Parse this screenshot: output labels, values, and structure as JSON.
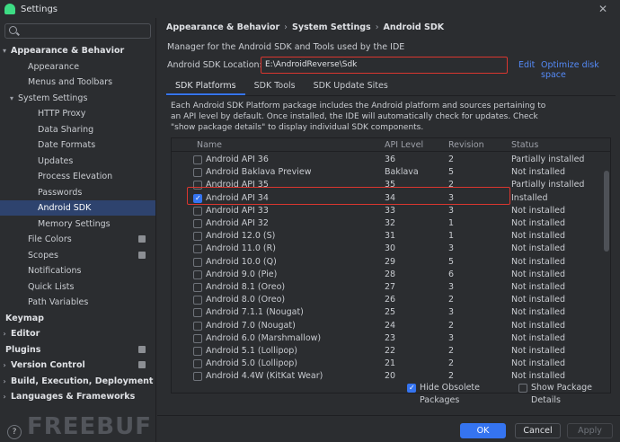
{
  "window": {
    "title": "Settings"
  },
  "search": {
    "placeholder": ""
  },
  "sidebar": {
    "items": [
      {
        "label": "Appearance & Behavior",
        "bold": true,
        "arrow": "▾",
        "indent": 0
      },
      {
        "label": "Appearance",
        "indent": 2
      },
      {
        "label": "Menus and Toolbars",
        "indent": 2
      },
      {
        "label": "System Settings",
        "arrow": "▾",
        "indent": 1
      },
      {
        "label": "HTTP Proxy",
        "indent": 3
      },
      {
        "label": "Data Sharing",
        "indent": 3
      },
      {
        "label": "Date Formats",
        "indent": 3
      },
      {
        "label": "Updates",
        "indent": 3
      },
      {
        "label": "Process Elevation",
        "indent": 3
      },
      {
        "label": "Passwords",
        "indent": 3
      },
      {
        "label": "Android SDK",
        "indent": 3,
        "selected": true
      },
      {
        "label": "Memory Settings",
        "indent": 3
      },
      {
        "label": "File Colors",
        "indent": 2,
        "project": true
      },
      {
        "label": "Scopes",
        "indent": 2,
        "project": true
      },
      {
        "label": "Notifications",
        "indent": 2
      },
      {
        "label": "Quick Lists",
        "indent": 2
      },
      {
        "label": "Path Variables",
        "indent": 2
      },
      {
        "label": "Keymap",
        "bold": true,
        "indent": 0
      },
      {
        "label": "Editor",
        "bold": true,
        "arrow": "›",
        "indent": 0
      },
      {
        "label": "Plugins",
        "bold": true,
        "indent": 0,
        "project": true
      },
      {
        "label": "Version Control",
        "bold": true,
        "arrow": "›",
        "indent": 0,
        "project": true
      },
      {
        "label": "Build, Execution, Deployment",
        "bold": true,
        "arrow": "›",
        "indent": 0
      },
      {
        "label": "Languages & Frameworks",
        "bold": true,
        "arrow": "›",
        "indent": 0
      }
    ],
    "help_label": "?",
    "watermark": "FREEBUF"
  },
  "main": {
    "breadcrumb": [
      "Appearance & Behavior",
      "System Settings",
      "Android SDK"
    ],
    "description": "Manager for the Android SDK and Tools used by the IDE",
    "location_label": "Android SDK Location:",
    "location_value": "E:\\AndroidReverse\\Sdk",
    "edit_link": "Edit",
    "optimize_link": "Optimize disk space",
    "tabs": [
      "SDK Platforms",
      "SDK Tools",
      "SDK Update Sites"
    ],
    "active_tab": 0,
    "tab_description": "Each Android SDK Platform package includes the Android platform and sources pertaining to an API level by default. Once installed, the IDE will automatically check for updates. Check \"show package details\" to display individual SDK components.",
    "columns": [
      "Name",
      "API Level",
      "Revision",
      "Status"
    ],
    "rows": [
      {
        "name": "Android API 36",
        "api": "36",
        "rev": "2",
        "status": "Partially installed",
        "checked": false
      },
      {
        "name": "Android Baklava Preview",
        "api": "Baklava",
        "rev": "5",
        "status": "Not installed",
        "checked": false
      },
      {
        "name": "Android API 35",
        "api": "35",
        "rev": "2",
        "status": "Partially installed",
        "checked": false
      },
      {
        "name": "Android API 34",
        "api": "34",
        "rev": "3",
        "status": "Installed",
        "checked": true
      },
      {
        "name": "Android API 33",
        "api": "33",
        "rev": "3",
        "status": "Not installed",
        "checked": false
      },
      {
        "name": "Android API 32",
        "api": "32",
        "rev": "1",
        "status": "Not installed",
        "checked": false
      },
      {
        "name": "Android 12.0 (S)",
        "api": "31",
        "rev": "1",
        "status": "Not installed",
        "checked": false
      },
      {
        "name": "Android 11.0 (R)",
        "api": "30",
        "rev": "3",
        "status": "Not installed",
        "checked": false
      },
      {
        "name": "Android 10.0 (Q)",
        "api": "29",
        "rev": "5",
        "status": "Not installed",
        "checked": false
      },
      {
        "name": "Android 9.0 (Pie)",
        "api": "28",
        "rev": "6",
        "status": "Not installed",
        "checked": false
      },
      {
        "name": "Android 8.1 (Oreo)",
        "api": "27",
        "rev": "3",
        "status": "Not installed",
        "checked": false
      },
      {
        "name": "Android 8.0 (Oreo)",
        "api": "26",
        "rev": "2",
        "status": "Not installed",
        "checked": false
      },
      {
        "name": "Android 7.1.1 (Nougat)",
        "api": "25",
        "rev": "3",
        "status": "Not installed",
        "checked": false
      },
      {
        "name": "Android 7.0 (Nougat)",
        "api": "24",
        "rev": "2",
        "status": "Not installed",
        "checked": false
      },
      {
        "name": "Android 6.0 (Marshmallow)",
        "api": "23",
        "rev": "3",
        "status": "Not installed",
        "checked": false
      },
      {
        "name": "Android 5.1 (Lollipop)",
        "api": "22",
        "rev": "2",
        "status": "Not installed",
        "checked": false
      },
      {
        "name": "Android 5.0 (Lollipop)",
        "api": "21",
        "rev": "2",
        "status": "Not installed",
        "checked": false
      },
      {
        "name": "Android 4.4W (KitKat Wear)",
        "api": "20",
        "rev": "2",
        "status": "Not installed",
        "checked": false
      }
    ],
    "hide_obsolete_label": "Hide Obsolete Packages",
    "hide_obsolete_checked": true,
    "show_details_label": "Show Package Details",
    "show_details_checked": false
  },
  "footer": {
    "ok": "OK",
    "cancel": "Cancel",
    "apply": "Apply"
  }
}
